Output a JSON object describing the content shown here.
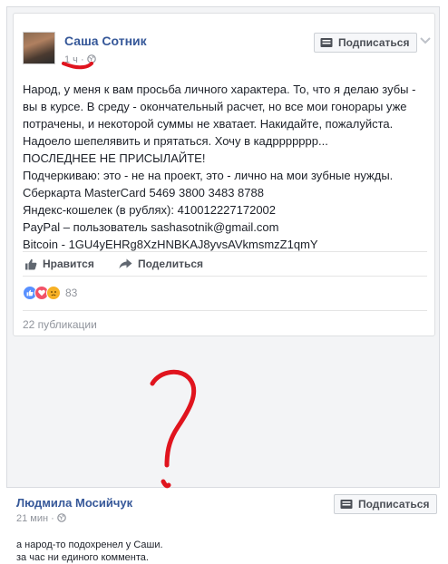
{
  "post": {
    "author": "Саша Сотник",
    "time": "1 ч",
    "subscribe_label": "Подписаться",
    "lines": [
      "Народ, у меня к вам просьба личного характера. То, что я делаю зубы -",
      "вы в курсе. В среду - окончательный расчет, но все мои гонорары уже",
      "потрачены, и некоторой суммы не хватает. Накидайте, пожалуйста.",
      "Надоело шепелявить и прятаться. Хочу в кадррррррр...",
      "ПОСЛЕДНЕЕ НЕ ПРИСЫЛАЙТЕ!",
      "Подчеркиваю: это - не на проект, это - лично на мои зубные нужды.",
      "Сберкарта MasterCard 5469 3800 3483 8788",
      "Яндекс-кошелек (в рублях): 410012227172002",
      "PayPal – пользователь sashasotnik@gmail.com",
      "Bitcoin - 1GU4yEHRg8XzHNBKAJ8yvsAVkmsmzZ1qmY"
    ],
    "like_label": "Нравится",
    "share_label": "Поделиться",
    "reactions_count": "83",
    "shares_label": "22 публикации"
  },
  "comment": {
    "author": "Людмила Мосийчук",
    "time": "21 мин",
    "subscribe_label": "Подписаться",
    "lines": [
      "а народ-то подохренел у Саши.",
      "за час ни единого коммента."
    ]
  },
  "colors": {
    "link": "#365899",
    "muted": "#90949c",
    "annotation_red": "#e0141e",
    "like_blue": "#5890ff",
    "love_red": "#f25268",
    "sad_yellow": "#f7b125"
  },
  "icons": [
    "subscribe-icon",
    "chevron-down-icon",
    "globe-icon",
    "like-icon",
    "share-icon",
    "like-reaction-icon",
    "love-reaction-icon",
    "sad-reaction-icon"
  ]
}
